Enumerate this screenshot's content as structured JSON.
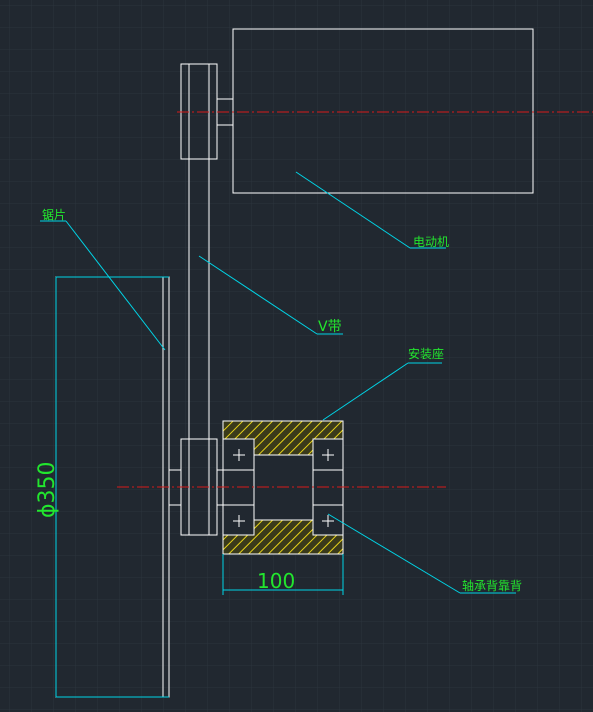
{
  "drawing": {
    "labels": {
      "motor": "电动机",
      "belt": "V带",
      "blade": "锯片",
      "mount": "安装座",
      "bearing": "轴承背靠背"
    },
    "dimensions": {
      "diameter": "ϕ350",
      "width": "100"
    },
    "colors": {
      "background": "#212830",
      "grid": "#2c343d",
      "outline": "#ffffff",
      "leader": "#00d4e6",
      "text": "#22e62e",
      "centerline": "#d81a1a",
      "hatch": "#e6d21a"
    }
  }
}
